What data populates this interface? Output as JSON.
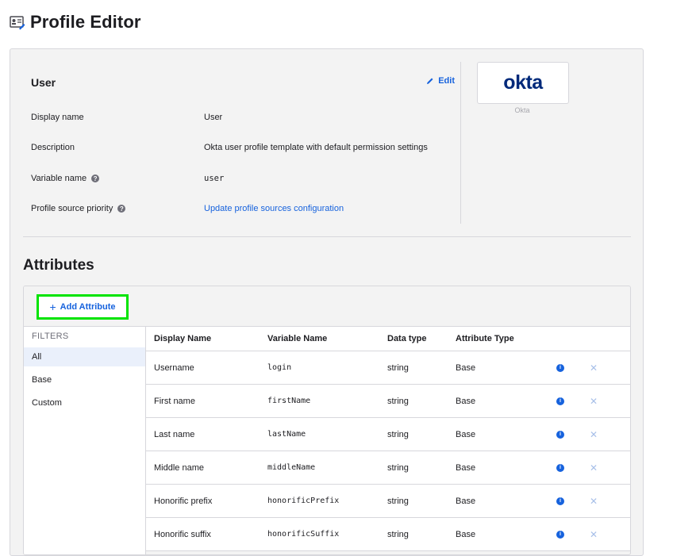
{
  "page": {
    "title": "Profile Editor"
  },
  "user_profile": {
    "heading": "User",
    "edit_label": "Edit",
    "rows": [
      {
        "label": "Display name",
        "value": "User"
      },
      {
        "label": "Description",
        "value": "Okta user profile template with default permission settings"
      },
      {
        "label": "Variable name",
        "value": "user"
      },
      {
        "label": "Profile source priority",
        "value": "Update profile sources configuration"
      }
    ],
    "logo_text": "okta",
    "logo_caption": "Okta"
  },
  "attributes": {
    "heading": "Attributes",
    "add_button_label": "Add Attribute",
    "filters": {
      "heading": "FILTERS",
      "items": [
        "All",
        "Base",
        "Custom"
      ],
      "active": "All"
    },
    "columns": [
      "Display Name",
      "Variable Name",
      "Data type",
      "Attribute Type"
    ],
    "rows": [
      {
        "display_name": "Username",
        "variable_name": "login",
        "data_type": "string",
        "attribute_type": "Base"
      },
      {
        "display_name": "First name",
        "variable_name": "firstName",
        "data_type": "string",
        "attribute_type": "Base"
      },
      {
        "display_name": "Last name",
        "variable_name": "lastName",
        "data_type": "string",
        "attribute_type": "Base"
      },
      {
        "display_name": "Middle name",
        "variable_name": "middleName",
        "data_type": "string",
        "attribute_type": "Base"
      },
      {
        "display_name": "Honorific prefix",
        "variable_name": "honorificPrefix",
        "data_type": "string",
        "attribute_type": "Base"
      },
      {
        "display_name": "Honorific suffix",
        "variable_name": "honorificSuffix",
        "data_type": "string",
        "attribute_type": "Base"
      }
    ]
  },
  "colors": {
    "link": "#1662dd",
    "highlight": "#00e400",
    "okta_brand": "#00297a"
  },
  "icons": [
    "profile-editor-icon",
    "pencil-icon",
    "help-icon",
    "plus-icon",
    "info-icon",
    "close-icon"
  ]
}
